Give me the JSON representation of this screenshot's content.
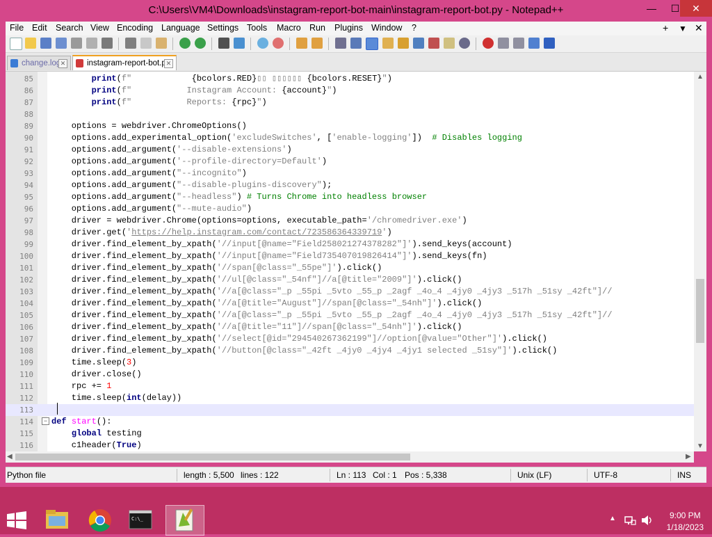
{
  "window": {
    "title": "C:\\Users\\VM4\\Downloads\\instagram-report-bot-main\\instagram-report-bot.py - Notepad++",
    "minimize_glyph": "—",
    "maximize_glyph": "☐",
    "close_glyph": "✕"
  },
  "menu": {
    "items": [
      "File",
      "Edit",
      "Search",
      "View",
      "Encoding",
      "Language",
      "Settings",
      "Tools",
      "Macro",
      "Run",
      "Plugins",
      "Window",
      "?"
    ],
    "right_plus": "+",
    "right_down": "▼",
    "right_close": "✕"
  },
  "tabs": [
    {
      "label": "change.log",
      "close": "✕"
    },
    {
      "label": "instagram-report-bot.py",
      "close": "✕"
    }
  ],
  "editor": {
    "lines": [
      {
        "n": "85",
        "html": "        <span class='kw'>print</span>(<span class='str'>f\"</span><span class='str'>            </span>{bcolors.RED}<span class='str'>▯▯ ▯▯▯▯▯▯ </span>{bcolors.RESET}<span class='str'>\"</span>)"
      },
      {
        "n": "86",
        "html": "        <span class='kw'>print</span>(<span class='str'>f\"           Instagram Account: </span>{account}<span class='str'>\"</span>)"
      },
      {
        "n": "87",
        "html": "        <span class='kw'>print</span>(<span class='str'>f\"           Reports: </span>{rpc}<span class='str'>\"</span>)"
      },
      {
        "n": "88",
        "html": ""
      },
      {
        "n": "89",
        "html": "    options = webdriver.ChromeOptions()"
      },
      {
        "n": "90",
        "html": "    options.add_experimental_option(<span class='str'>'excludeSwitches'</span>, [<span class='str'>'enable-logging'</span>])  <span class='cm'># Disables logging</span>"
      },
      {
        "n": "91",
        "html": "    options.add_argument(<span class='str'>'--disable-extensions'</span>)"
      },
      {
        "n": "92",
        "html": "    options.add_argument(<span class='str'>'--profile-directory=Default'</span>)"
      },
      {
        "n": "93",
        "html": "    options.add_argument(<span class='str'>\"--incognito\"</span>)"
      },
      {
        "n": "94",
        "html": "    options.add_argument(<span class='str'>\"--disable-plugins-discovery\"</span>);"
      },
      {
        "n": "95",
        "html": "    options.add_argument(<span class='str'>\"--headless\"</span>) <span class='cm'># Turns Chrome into headless browser</span>"
      },
      {
        "n": "96",
        "html": "    options.add_argument(<span class='str'>\"--mute-audio\"</span>)"
      },
      {
        "n": "97",
        "html": "    driver = webdriver.Chrome(options=options, executable_path=<span class='str'>'/chromedriver.exe'</span>)"
      },
      {
        "n": "98",
        "html": "    driver.get(<span class='str'>'<u>https://help.instagram.com/contact/723586364339719</u>'</span>)"
      },
      {
        "n": "99",
        "html": "    driver.find_element_by_xpath(<span class='str'>'//input[@name=\"Field258021274378282\"]'</span>).send_keys(account)"
      },
      {
        "n": "100",
        "html": "    driver.find_element_by_xpath(<span class='str'>'//input[@name=\"Field735407019826414\"]'</span>).send_keys(fn)"
      },
      {
        "n": "101",
        "html": "    driver.find_element_by_xpath(<span class='str'>'//span[@class=\"_55pe\"]'</span>).click()"
      },
      {
        "n": "102",
        "html": "    driver.find_element_by_xpath(<span class='str'>'//ul[@class=\"_54nf\"]//a[@title=\"2009\"]'</span>).click()"
      },
      {
        "n": "103",
        "html": "    driver.find_element_by_xpath(<span class='str'>'//a[@class=\"_p _55pi _5vto _55_p _2agf _4o_4 _4jy0 _4jy3 _517h _51sy _42ft\"]//</span>"
      },
      {
        "n": "104",
        "html": "    driver.find_element_by_xpath(<span class='str'>'//a[@title=\"August\"]//span[@class=\"_54nh\"]'</span>).click()"
      },
      {
        "n": "105",
        "html": "    driver.find_element_by_xpath(<span class='str'>'//a[@class=\"_p _55pi _5vto _55_p _2agf _4o_4 _4jy0 _4jy3 _517h _51sy _42ft\"]//</span>"
      },
      {
        "n": "106",
        "html": "    driver.find_element_by_xpath(<span class='str'>'//a[@title=\"11\"]//span[@class=\"_54nh\"]'</span>).click()"
      },
      {
        "n": "107",
        "html": "    driver.find_element_by_xpath(<span class='str'>'//select[@id=\"294540267362199\"]//option[@value=\"Other\"]'</span>).click()"
      },
      {
        "n": "108",
        "html": "    driver.find_element_by_xpath(<span class='str'>'//button[@class=\"_42ft _4jy0 _4jy4 _4jy1 selected _51sy\"]'</span>).click()"
      },
      {
        "n": "109",
        "html": "    time.sleep(<span class='num'>3</span>)"
      },
      {
        "n": "110",
        "html": "    driver.close()"
      },
      {
        "n": "111",
        "html": "    rpc += <span class='num'>1</span>"
      },
      {
        "n": "112",
        "html": "    time.sleep(<span class='kw'>int</span>(delay))"
      },
      {
        "n": "113",
        "html": ""
      },
      {
        "n": "114",
        "html": "<span class='kw'>def</span> <span style='color:#ff00ff'>start</span>():"
      },
      {
        "n": "115",
        "html": "    <span class='kw'>global</span> testing"
      },
      {
        "n": "116",
        "html": "    c1header(<span class='kw'>True</span>)"
      }
    ]
  },
  "status": {
    "type": "Python file",
    "length": "length : 5,500",
    "lines": "lines : 122",
    "ln": "Ln : 113",
    "col": "Col : 1",
    "pos": "Pos : 5,338",
    "eol": "Unix (LF)",
    "encoding": "UTF-8",
    "mode": "INS"
  },
  "taskbar": {
    "clock_time": "9:00 PM",
    "clock_date": "1/18/2023"
  }
}
